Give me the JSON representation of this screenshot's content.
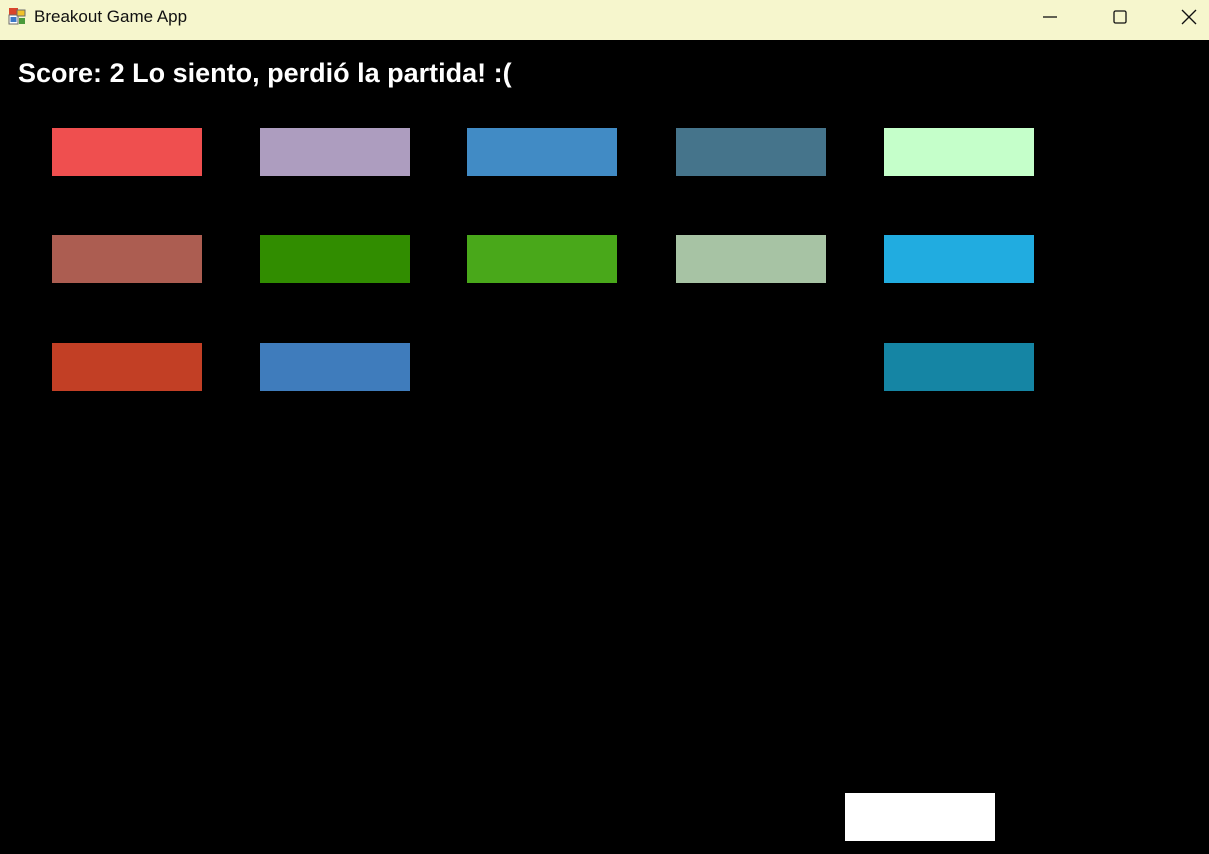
{
  "window": {
    "title": "Breakout Game App",
    "icon": "windows-forms-app-icon",
    "controls": {
      "minimize": "minimize-icon",
      "maximize": "maximize-icon",
      "close": "close-icon"
    }
  },
  "game": {
    "score_label": "Score:",
    "score_value": "2",
    "status_message": "Lo siento, perdió la partida! :(",
    "background_color": "#000000",
    "paddle_color": "#ffffff",
    "bricks": [
      [
        {
          "color": "#ef4f4f"
        },
        {
          "color": "#ad9dbf"
        },
        {
          "color": "#418bc5"
        },
        {
          "color": "#45748b"
        },
        {
          "color": "#c5ffca"
        }
      ],
      [
        {
          "color": "#ac5d51"
        },
        {
          "color": "#318d00"
        },
        {
          "color": "#49a81a"
        },
        {
          "color": "#a7c3a4"
        },
        {
          "color": "#21ace0"
        }
      ],
      [
        {
          "color": "#c23f25"
        },
        {
          "color": "#3f7cbc"
        },
        null,
        null,
        {
          "color": "#1585a4"
        }
      ]
    ]
  }
}
